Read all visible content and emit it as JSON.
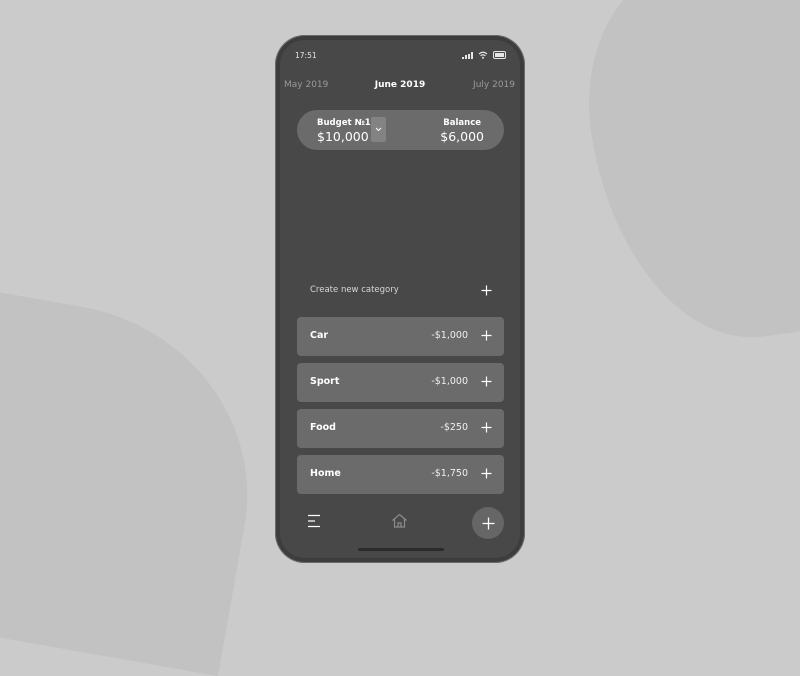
{
  "status_bar": {
    "time": "17:51"
  },
  "months": {
    "prev": "May 2019",
    "current": "June 2019",
    "next": "July 2019"
  },
  "budget": {
    "name": "Budget №1",
    "amount": "$10,000",
    "balance_label": "Balance",
    "balance_amount": "$6,000"
  },
  "create_category": {
    "label": "Create new category"
  },
  "categories": [
    {
      "name": "Car",
      "amount": "-$1,000"
    },
    {
      "name": "Sport",
      "amount": "-$1,000"
    },
    {
      "name": "Food",
      "amount": "-$250"
    },
    {
      "name": "Home",
      "amount": "-$1,750"
    }
  ],
  "icons": {
    "menu": "menu-icon",
    "home": "home-icon",
    "add": "plus-icon",
    "dropdown": "chevron-down-icon",
    "signal": "signal-icon",
    "wifi": "wifi-icon",
    "battery": "battery-icon"
  },
  "colors": {
    "background": "#cbcbcb",
    "phone_body": "#3d3d3d",
    "screen": "#484848",
    "card": "#6b6b6b",
    "fab": "#666666"
  }
}
